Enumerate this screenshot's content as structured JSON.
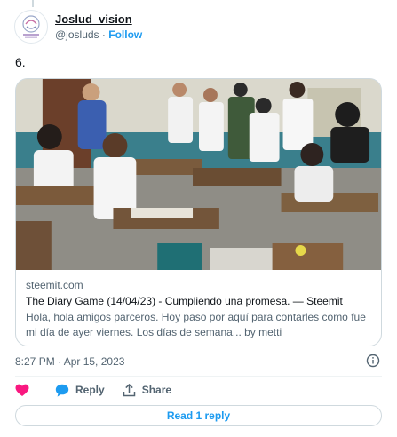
{
  "author": {
    "display_name": "Joslud_vision",
    "handle": "@josluds",
    "separator": "·",
    "follow_label": "Follow"
  },
  "tweet": {
    "text": "6.",
    "timestamp": "8:27 PM · Apr 15, 2023"
  },
  "link_card": {
    "domain": "steemit.com",
    "title": "The Diary Game (14/04/23) - Cumpliendo una promesa. — Steemit",
    "description": "Hola, hola amigos parceros. Hoy paso por aquí para contarles como fue mi día de ayer viernes. Los días de semana... by metti"
  },
  "actions": {
    "like_icon": "heart-icon",
    "reply_label": "Reply",
    "reply_icon": "speech-bubble-icon",
    "share_label": "Share",
    "share_icon": "share-upload-icon"
  },
  "read_replies_label": "Read 1 reply",
  "colors": {
    "link_blue": "#1d9bf0",
    "like_pink": "#f91880",
    "secondary_text": "#536471",
    "border": "#cfd9de"
  }
}
